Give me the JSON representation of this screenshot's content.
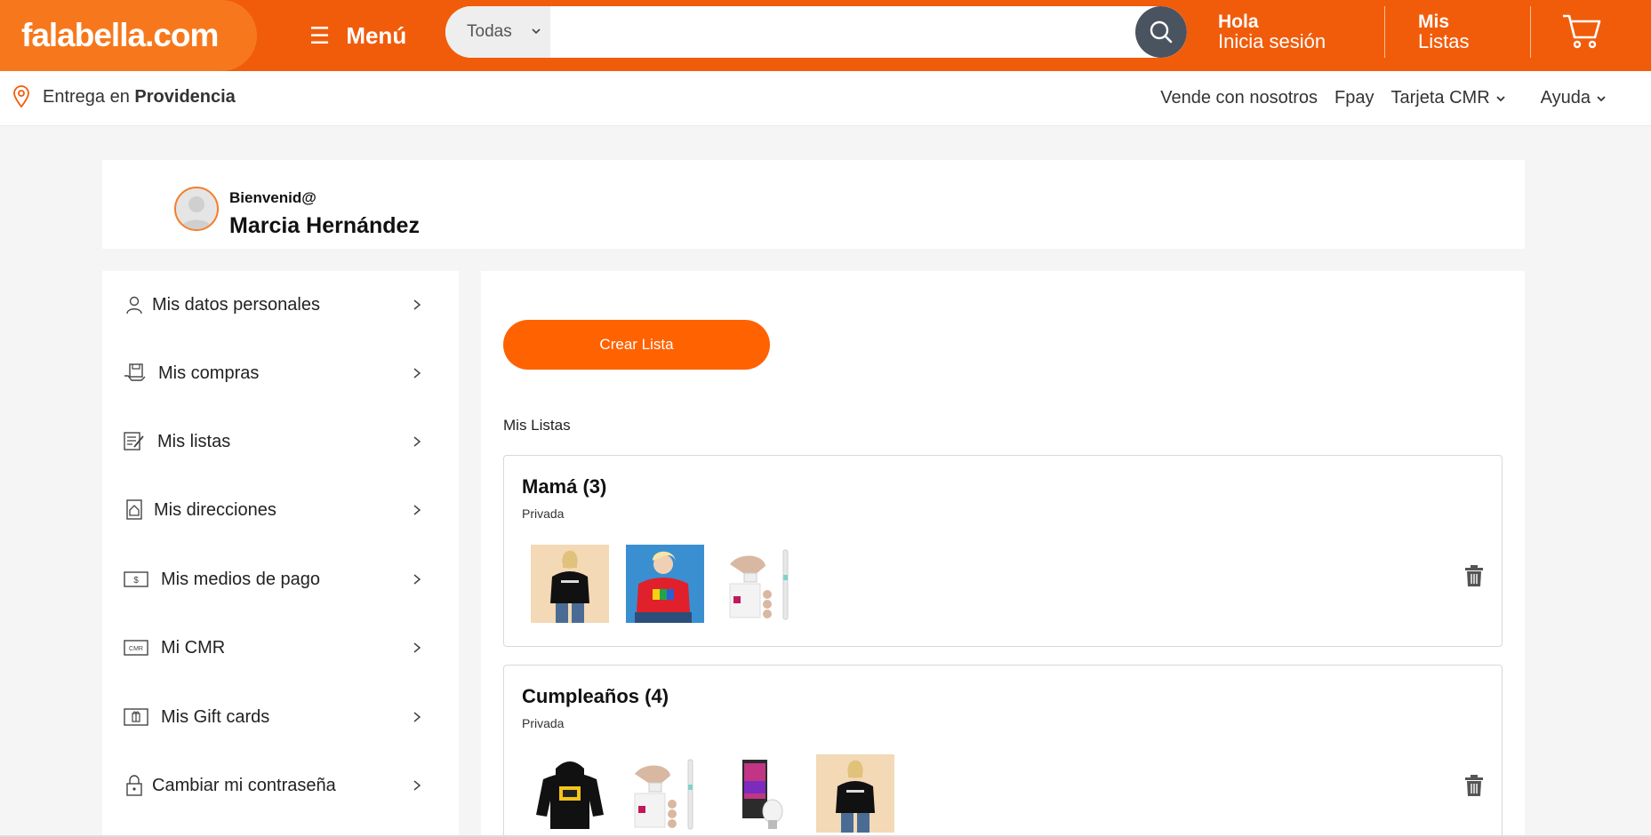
{
  "header": {
    "logo": "falabella.com",
    "menu_label": "Menú",
    "search": {
      "category": "Todas",
      "value": "",
      "placeholder": ""
    },
    "login_line1": "Hola",
    "login_line2": "Inicia sesión",
    "lists_line1": "Mis",
    "lists_line2": "Listas",
    "brand_color": "#f15c0b"
  },
  "subheader": {
    "delivery_prefix": "Entrega en",
    "delivery_location": "Providencia",
    "links": [
      "Vende con nosotros",
      "Fpay",
      "Tarjeta CMR",
      "Ayuda"
    ]
  },
  "welcome": {
    "greeting": "Bienvenid@",
    "user_name": "Marcia Hernández"
  },
  "sidebar": {
    "items": [
      {
        "label": "Mis datos personales",
        "icon": "user-icon"
      },
      {
        "label": "Mis compras",
        "icon": "purchases-icon"
      },
      {
        "label": "Mis listas",
        "icon": "list-icon"
      },
      {
        "label": "Mis direcciones",
        "icon": "address-icon"
      },
      {
        "label": "Mis medios de pago",
        "icon": "payment-icon"
      },
      {
        "label": "Mi CMR",
        "icon": "cmr-card-icon"
      },
      {
        "label": "Mis Gift cards",
        "icon": "gift-card-icon"
      },
      {
        "label": "Cambiar mi contraseña",
        "icon": "lock-icon"
      }
    ]
  },
  "main": {
    "create_button": "Crear Lista",
    "section_title": "Mis Listas",
    "lists": [
      {
        "name": "Mamá (3)",
        "privacy": "Privada",
        "thumbnails": [
          "black-hoodie-woman-photo",
          "red-sweater-woman-photo",
          "philips-ipl-toothbrush-photo"
        ]
      },
      {
        "name": "Cumpleaños (4)",
        "privacy": "Privada",
        "thumbnails": [
          "black-hoodie-photo",
          "philips-ipl-toothbrush-photo",
          "smart-bulb-box-photo",
          "black-hoodie-woman-photo"
        ]
      }
    ]
  }
}
